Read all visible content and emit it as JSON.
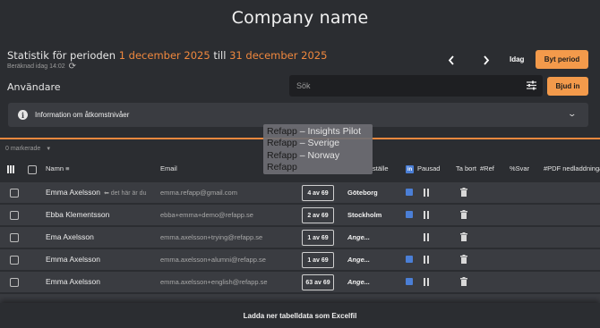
{
  "app": {
    "title": "Company name"
  },
  "period": {
    "prefix": "Statistik för perioden",
    "start": "1 december 2025",
    "middle": "till",
    "end": "31 december 2025",
    "calculated": "Beräknad idag 14:02"
  },
  "controls": {
    "prev_icon": "chevron-left-icon",
    "next_icon": "chevron-right-icon",
    "today_label": "Idag",
    "change_period_label": "Byt period"
  },
  "users": {
    "heading": "Användare",
    "search_placeholder": "Sök",
    "invite_label": "Bjud in"
  },
  "info": {
    "text": "Information om åtkomstnivåer"
  },
  "selection": {
    "marked_label": "0 markerade"
  },
  "table": {
    "headers": {
      "name": "Namn",
      "email": "Email",
      "place": "ställe",
      "paused": "Pausad",
      "remove": "Ta bort",
      "ref": "#Ref",
      "answers": "%Svar",
      "pdf": "#PDF nedladdningar"
    },
    "rows": [
      {
        "name": "Emma Axelsson",
        "hint": "⬅ det här är du",
        "email": "emma.refapp@gmail.com",
        "count": "4 av 69",
        "place": "Göteborg",
        "linkedin": true
      },
      {
        "name": "Ebba Klementsson",
        "hint": "",
        "email": "ebba+emma+demo@refapp.se",
        "count": "2 av 69",
        "place": "Stockholm",
        "linkedin": true
      },
      {
        "name": "Ema Axelsson",
        "hint": "",
        "email": "emma.axelsson+trying@refapp.se",
        "count": "1 av 69",
        "place": "Ange...",
        "linkedin": false
      },
      {
        "name": "Emma Axelsson",
        "hint": "",
        "email": "emma.axelsson+alumni@refapp.se",
        "count": "1 av 69",
        "place": "Ange...",
        "linkedin": true
      },
      {
        "name": "Emma Axelsson",
        "hint": "",
        "email": "emma.axelsson+english@refapp.se",
        "count": "63 av 69",
        "place": "Ange...",
        "linkedin": true
      }
    ]
  },
  "tooltip": {
    "items": [
      {
        "prefix": "Refapp",
        "suffix": " – Insights Pilot"
      },
      {
        "prefix": "Refapp",
        "suffix": " – Sverige"
      },
      {
        "prefix": "Refapp",
        "suffix": " – Norway"
      },
      {
        "prefix": "Refapp",
        "suffix": ""
      }
    ]
  },
  "footer": {
    "download_label": "Ladda ner tabelldata som Excelfil"
  },
  "colors": {
    "accent": "#f0883e",
    "button": "#f39a4b",
    "linkedin": "#4b7fd6",
    "row_bg": "#3a3c41",
    "page_bg": "#2b2d31"
  }
}
